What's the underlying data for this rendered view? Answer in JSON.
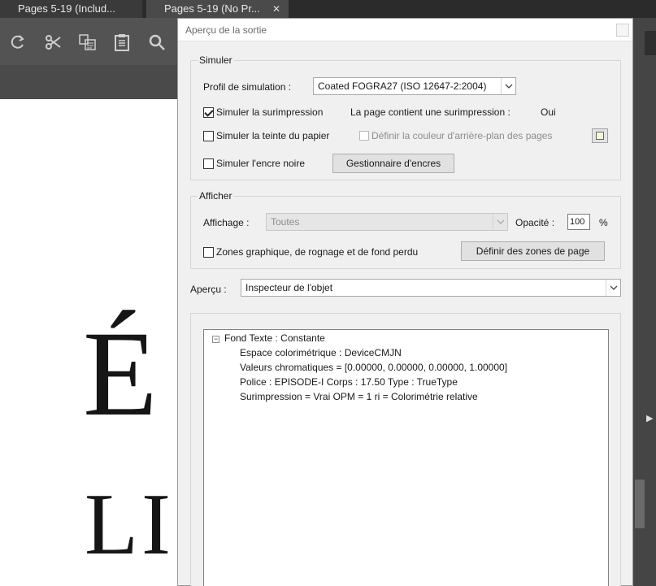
{
  "tabs": [
    {
      "label": "Pages 5-19 (Includ..."
    },
    {
      "label": "Pages 5-19 (No Pr...",
      "close": "✕"
    }
  ],
  "document": {
    "line1": "É",
    "line2": "LI"
  },
  "dialog": {
    "title": "Aperçu de la sortie",
    "simulate": {
      "legend": "Simuler",
      "profile_label": "Profil de simulation :",
      "profile_value": "Coated FOGRA27 (ISO 12647-2:2004)",
      "overprint_label": "Simuler la surimpression",
      "overprint_checked": true,
      "page_contains_label": "La page contient une surimpression :",
      "page_contains_value": "Oui",
      "paper_tint_label": "Simuler la teinte du papier",
      "paper_tint_checked": false,
      "bg_color_label": "Définir la couleur d'arrière-plan des pages",
      "black_ink_label": "Simuler l'encre noire",
      "black_ink_checked": false,
      "ink_manager_button": "Gestionnaire d'encres"
    },
    "show": {
      "legend": "Afficher",
      "display_label": "Affichage :",
      "display_value": "Toutes",
      "opacity_label": "Opacité :",
      "opacity_value": "100",
      "opacity_unit": "%",
      "zones_label": "Zones graphique, de rognage et de fond perdu",
      "zones_checked": false,
      "define_zones_button": "Définir des zones de page"
    },
    "preview": {
      "label": "Aperçu :",
      "value": "Inspecteur de l'objet"
    },
    "inspector": {
      "root_toggle": "−",
      "root": "Fond Texte : Constante",
      "children": [
        "Espace colorimétrique : DeviceCMJN",
        "Valeurs chromatiques = [0.00000, 0.00000, 0.00000, 1.00000]",
        "Police : EPISODE-I Corps : 17.50 Type : TrueType",
        "Surimpression = Vrai OPM = 1 ri = Colorimétrie relative"
      ]
    }
  },
  "icons": {
    "redo": "redo-icon",
    "cut": "scissors-icon",
    "copy": "copy-icon",
    "paste": "clipboard-icon",
    "search": "search-icon"
  }
}
